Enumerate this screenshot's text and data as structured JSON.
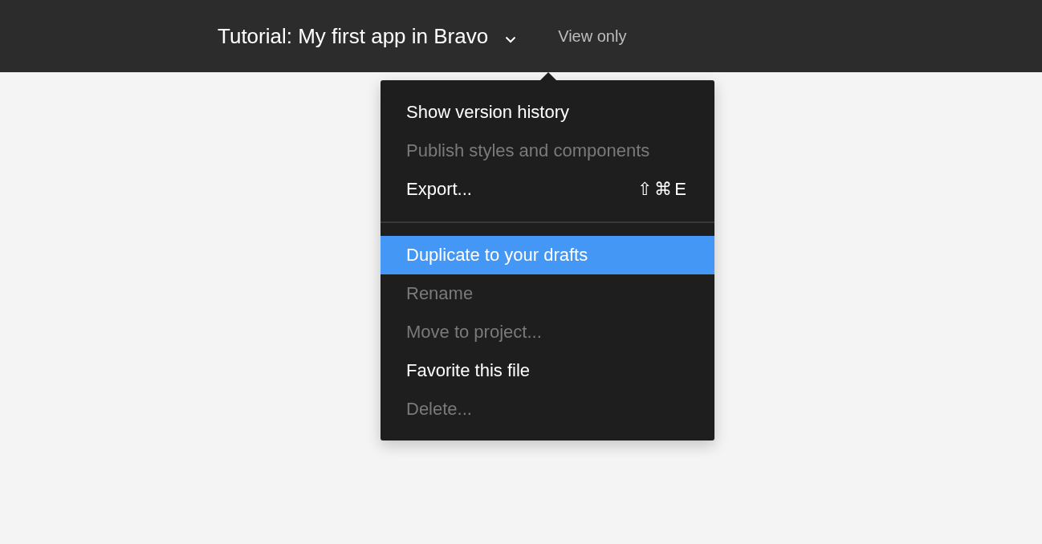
{
  "header": {
    "title": "Tutorial: My first app in Bravo",
    "access": "View only"
  },
  "menu": {
    "items": [
      {
        "kind": "item",
        "label": "Show version history",
        "disabled": false,
        "selected": false
      },
      {
        "kind": "item",
        "label": "Publish styles and components",
        "disabled": true,
        "selected": false
      },
      {
        "kind": "item",
        "label": "Export...",
        "shortcut": "⇧⌘E",
        "disabled": false,
        "selected": false
      },
      {
        "kind": "separator"
      },
      {
        "kind": "item",
        "label": "Duplicate to your drafts",
        "disabled": false,
        "selected": true
      },
      {
        "kind": "item",
        "label": "Rename",
        "disabled": true,
        "selected": false
      },
      {
        "kind": "item",
        "label": "Move to project...",
        "disabled": true,
        "selected": false
      },
      {
        "kind": "item",
        "label": "Favorite this file",
        "disabled": false,
        "selected": false
      },
      {
        "kind": "item",
        "label": "Delete...",
        "disabled": true,
        "selected": false
      }
    ]
  }
}
